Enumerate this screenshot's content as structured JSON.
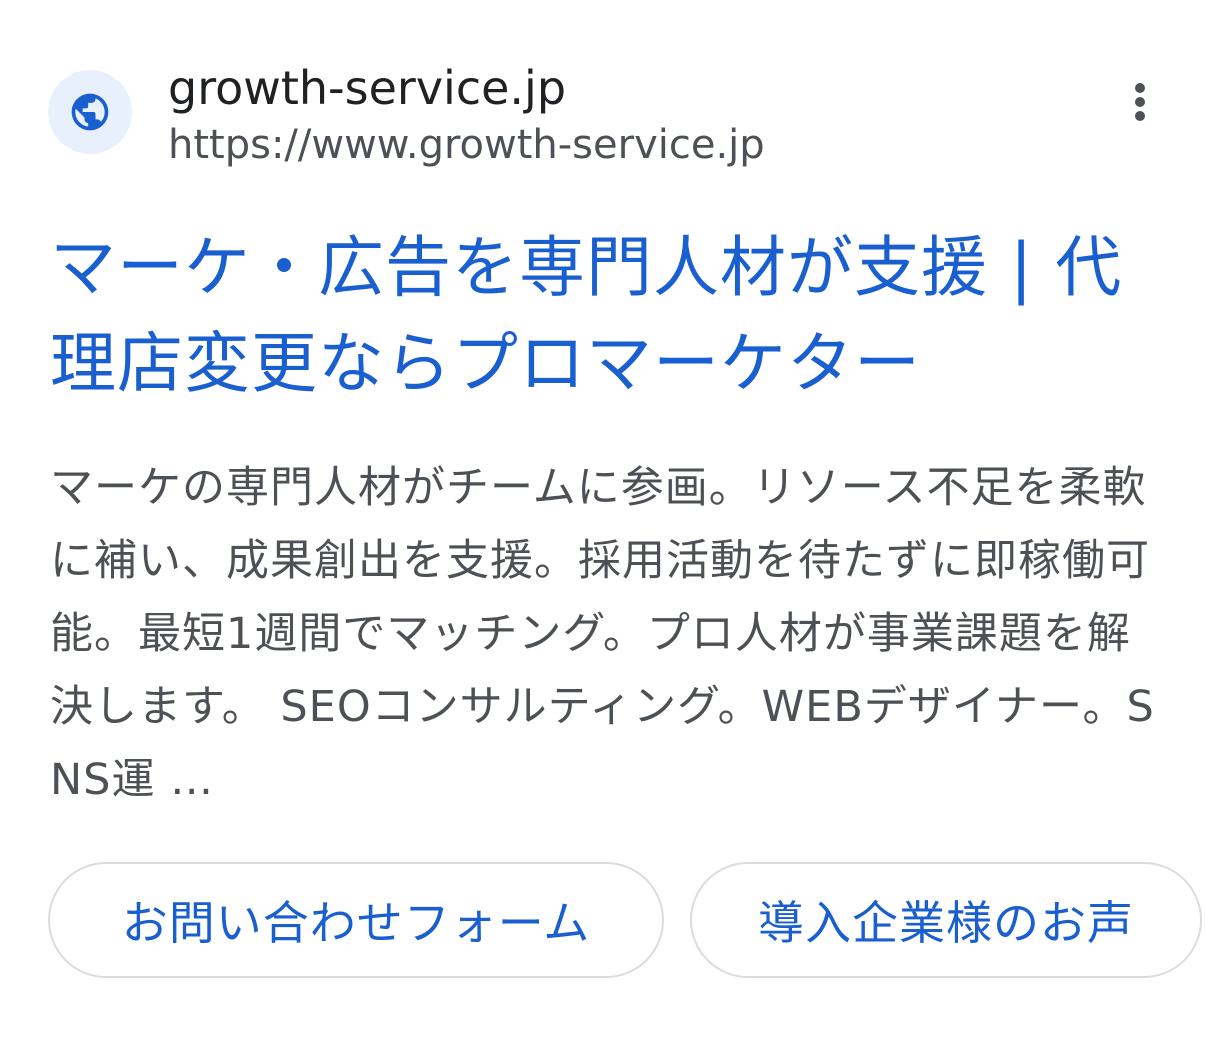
{
  "result": {
    "site_name": "growth-service.jp",
    "url": "https://www.growth-service.jp",
    "favicon_icon": "globe-icon",
    "more_icon": "more-vert-icon",
    "title": "マーケ・広告を専門人材が支援 | 代理店変更ならプロマーケター",
    "snippet": "マーケの専門人材がチームに参画。リソース不足を柔軟に補い、成果創出を支援。採用活動を待たずに即稼働可能。最短1週間でマッチング。プロ人材が事業課題を解決します。 SEOコンサルティング。WEBデザイナー。SNS運 …",
    "sitelinks": [
      {
        "label": "お問い合わせフォーム"
      },
      {
        "label": "導入企業様のお声"
      }
    ]
  },
  "colors": {
    "link": "#1a5fd0",
    "text": "#202124",
    "secondary_text": "#4d5156",
    "favicon_bg": "#e8f0fe",
    "favicon_fg": "#1a5fd0",
    "chip_border": "#dadce0"
  }
}
